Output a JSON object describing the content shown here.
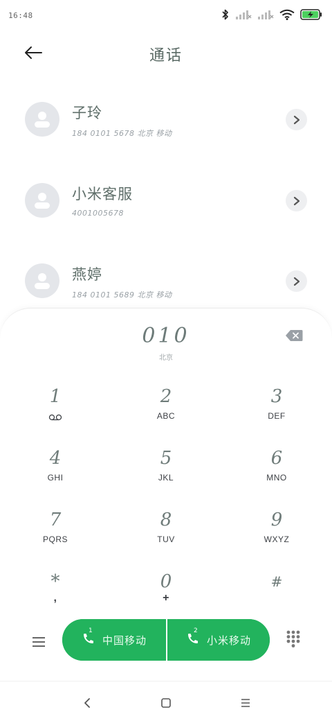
{
  "status": {
    "time": "16:48"
  },
  "header": {
    "title": "通话"
  },
  "contacts": [
    {
      "name": "子玲",
      "sub": "184 0101 5678 北京 移动"
    },
    {
      "name": "小米客服",
      "sub": "4001005678"
    },
    {
      "name": "燕婷",
      "sub": "184 0101 5689 北京 移动"
    }
  ],
  "dialer": {
    "number": "010",
    "location": "北京",
    "keys": [
      {
        "digit": "1",
        "letters": ""
      },
      {
        "digit": "2",
        "letters": "ABC"
      },
      {
        "digit": "3",
        "letters": "DEF"
      },
      {
        "digit": "4",
        "letters": "GHI"
      },
      {
        "digit": "5",
        "letters": "JKL"
      },
      {
        "digit": "6",
        "letters": "MNO"
      },
      {
        "digit": "7",
        "letters": "PQRS"
      },
      {
        "digit": "8",
        "letters": "TUV"
      },
      {
        "digit": "9",
        "letters": "WXYZ"
      },
      {
        "digit": "*",
        "letters": ","
      },
      {
        "digit": "0",
        "letters": "+"
      },
      {
        "digit": "#",
        "letters": ""
      }
    ]
  },
  "calls": [
    {
      "sim": "1",
      "label": "中国移动"
    },
    {
      "sim": "2",
      "label": "小米移动"
    }
  ],
  "colors": {
    "call_green": "#22b35d",
    "avatar_bg": "#e4e6ea",
    "accent_text": "#6f7c7a"
  },
  "icons": {
    "status": [
      "bluetooth-icon",
      "signal-icon",
      "signal-icon",
      "wifi-icon",
      "battery-charging-icon"
    ],
    "back": "back-arrow-icon",
    "detail": "chevron-right-icon",
    "backspace": "backspace-icon",
    "voicemail": "voicemail-icon",
    "menu": "menu-icon",
    "keypad": "keypad-icon",
    "nav": [
      "nav-back-icon",
      "nav-home-icon",
      "nav-recents-icon"
    ]
  }
}
